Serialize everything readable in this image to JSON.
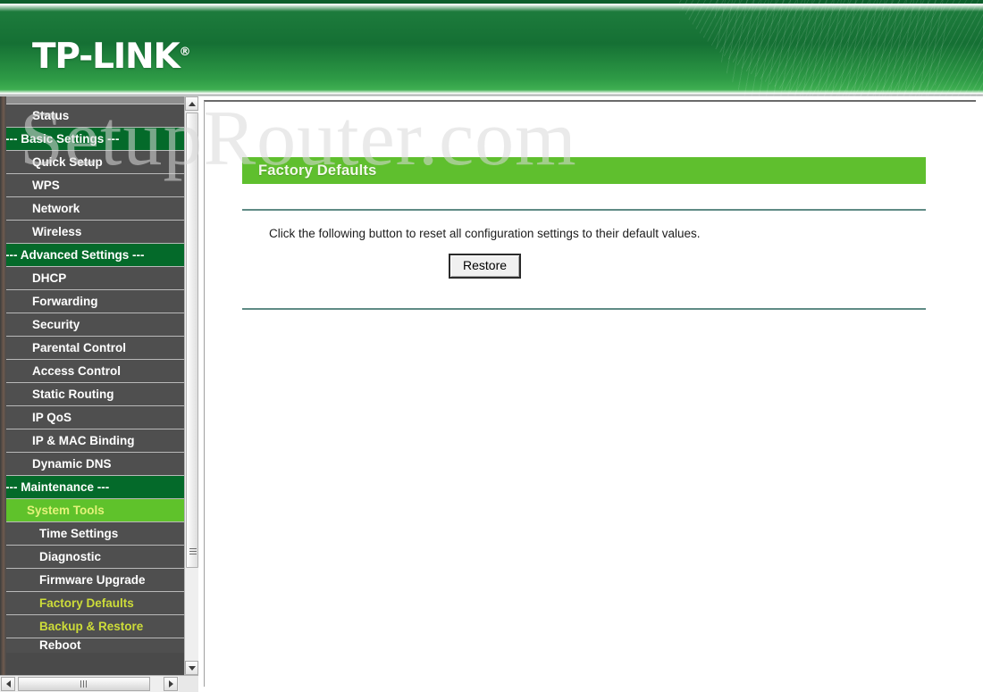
{
  "brand": {
    "logo_text": "TP-LINK",
    "registered_mark": "®"
  },
  "watermark": {
    "text": "SetupRouter.com"
  },
  "colors": {
    "banner_green": "#157034",
    "section_header_green": "#046a2a",
    "active_item_green": "#5fc22b",
    "title_bar_green": "#5fbf2e",
    "highlight_text_yellow": "#cddc39",
    "menu_background_gray": "#4f4f4f",
    "rule_teal": "#5f8b85"
  },
  "sidebar": {
    "items": [
      {
        "label": "Status",
        "type": "item",
        "state": "normal"
      },
      {
        "label": "--- Basic Settings ---",
        "type": "section",
        "state": "normal"
      },
      {
        "label": "Quick Setup",
        "type": "item",
        "state": "normal"
      },
      {
        "label": "WPS",
        "type": "item",
        "state": "normal"
      },
      {
        "label": "Network",
        "type": "item",
        "state": "normal"
      },
      {
        "label": "Wireless",
        "type": "item",
        "state": "normal"
      },
      {
        "label": "--- Advanced Settings ---",
        "type": "section",
        "state": "normal"
      },
      {
        "label": "DHCP",
        "type": "item",
        "state": "normal"
      },
      {
        "label": "Forwarding",
        "type": "item",
        "state": "normal"
      },
      {
        "label": "Security",
        "type": "item",
        "state": "normal"
      },
      {
        "label": "Parental Control",
        "type": "item",
        "state": "normal"
      },
      {
        "label": "Access Control",
        "type": "item",
        "state": "normal"
      },
      {
        "label": "Static Routing",
        "type": "item",
        "state": "normal"
      },
      {
        "label": "IP QoS",
        "type": "item",
        "state": "normal"
      },
      {
        "label": "IP & MAC Binding",
        "type": "item",
        "state": "normal"
      },
      {
        "label": "Dynamic DNS",
        "type": "item",
        "state": "normal"
      },
      {
        "label": "--- Maintenance ---",
        "type": "section",
        "state": "normal"
      },
      {
        "label": "System Tools",
        "type": "item",
        "state": "active"
      },
      {
        "label": "Time Settings",
        "type": "sub",
        "state": "normal"
      },
      {
        "label": "Diagnostic",
        "type": "sub",
        "state": "normal"
      },
      {
        "label": "Firmware Upgrade",
        "type": "sub",
        "state": "normal"
      },
      {
        "label": "Factory Defaults",
        "type": "sub",
        "state": "highlight"
      },
      {
        "label": "Backup & Restore",
        "type": "sub",
        "state": "highlight"
      },
      {
        "label": "Reboot",
        "type": "sub",
        "state": "normal",
        "clipped": true
      }
    ],
    "scrollbars": {
      "vertical_up_icon": "scroll-up-arrow-icon",
      "vertical_down_icon": "scroll-down-arrow-icon",
      "horizontal_left_icon": "scroll-left-arrow-icon",
      "horizontal_right_icon": "scroll-right-arrow-icon"
    }
  },
  "main": {
    "page_title": "Factory Defaults",
    "instruction": "Click the following button to reset all configuration settings to their default values.",
    "restore_button_label": "Restore"
  }
}
